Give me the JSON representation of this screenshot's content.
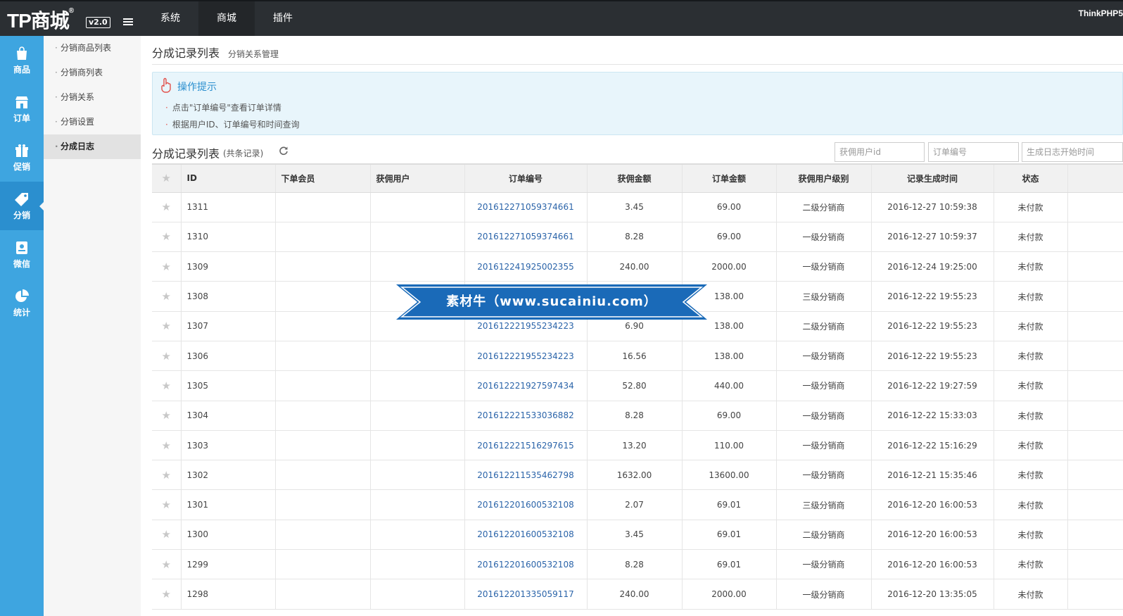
{
  "topbar": {
    "logo": "TP商城",
    "logo_mark": "®",
    "version": "v2.0",
    "tabs": [
      {
        "label": "系统"
      },
      {
        "label": "商城"
      },
      {
        "label": "插件"
      }
    ],
    "right_text": "ThinkPHP5"
  },
  "iconbar": {
    "items": [
      {
        "label": "商品",
        "icon": "shopping-bag-icon"
      },
      {
        "label": "订单",
        "icon": "store-icon"
      },
      {
        "label": "促销",
        "icon": "gift-icon"
      },
      {
        "label": "分销",
        "icon": "tag-icon",
        "active": true
      },
      {
        "label": "微信",
        "icon": "badge-icon"
      },
      {
        "label": "统计",
        "icon": "pie-chart-icon"
      }
    ]
  },
  "submenu": {
    "items": [
      {
        "label": "分销商品列表"
      },
      {
        "label": "分销商列表"
      },
      {
        "label": "分销关系"
      },
      {
        "label": "分销设置"
      },
      {
        "label": "分成日志",
        "active": true
      }
    ]
  },
  "page": {
    "title": "分成记录列表",
    "subtitle": "分销关系管理"
  },
  "tips": {
    "title": "操作提示",
    "items": [
      "点击\"订单编号\"查看订单详情",
      "根据用户ID、订单编号和时间查询"
    ]
  },
  "list": {
    "title": "分成记录列表",
    "count_text": "(共条记录)",
    "filters": {
      "user_id_placeholder": "获佣用户id",
      "order_sn_placeholder": "订单编号",
      "start_time_placeholder": "生成日志开始时间"
    },
    "columns": [
      "ID",
      "下单会员",
      "获佣用户",
      "订单编号",
      "获佣金额",
      "订单金额",
      "获佣用户级别",
      "记录生成时间",
      "状态"
    ],
    "rows": [
      {
        "id": "1311",
        "buyer": "",
        "earner": "",
        "order_sn": "201612271059374661",
        "commission": "3.45",
        "order_amount": "69.00",
        "level": "二级分销商",
        "time": "2016-12-27 10:59:38",
        "status": "未付款"
      },
      {
        "id": "1310",
        "buyer": "",
        "earner": "",
        "order_sn": "201612271059374661",
        "commission": "8.28",
        "order_amount": "69.00",
        "level": "一级分销商",
        "time": "2016-12-27 10:59:37",
        "status": "未付款"
      },
      {
        "id": "1309",
        "buyer": "",
        "earner": "",
        "order_sn": "201612241925002355",
        "commission": "240.00",
        "order_amount": "2000.00",
        "level": "一级分销商",
        "time": "2016-12-24 19:25:00",
        "status": "未付款"
      },
      {
        "id": "1308",
        "buyer": "",
        "earner": "",
        "order_sn": "",
        "commission": "",
        "order_amount": "138.00",
        "level": "三级分销商",
        "time": "2016-12-22 19:55:23",
        "status": "未付款"
      },
      {
        "id": "1307",
        "buyer": "",
        "earner": "",
        "order_sn": "201612221955234223",
        "commission": "6.90",
        "order_amount": "138.00",
        "level": "二级分销商",
        "time": "2016-12-22 19:55:23",
        "status": "未付款"
      },
      {
        "id": "1306",
        "buyer": "",
        "earner": "",
        "order_sn": "201612221955234223",
        "commission": "16.56",
        "order_amount": "138.00",
        "level": "一级分销商",
        "time": "2016-12-22 19:55:23",
        "status": "未付款"
      },
      {
        "id": "1305",
        "buyer": "",
        "earner": "",
        "order_sn": "201612221927597434",
        "commission": "52.80",
        "order_amount": "440.00",
        "level": "一级分销商",
        "time": "2016-12-22 19:27:59",
        "status": "未付款"
      },
      {
        "id": "1304",
        "buyer": "",
        "earner": "",
        "order_sn": "201612221533036882",
        "commission": "8.28",
        "order_amount": "69.00",
        "level": "一级分销商",
        "time": "2016-12-22 15:33:03",
        "status": "未付款"
      },
      {
        "id": "1303",
        "buyer": "",
        "earner": "",
        "order_sn": "201612221516297615",
        "commission": "13.20",
        "order_amount": "110.00",
        "level": "一级分销商",
        "time": "2016-12-22 15:16:29",
        "status": "未付款"
      },
      {
        "id": "1302",
        "buyer": "",
        "earner": "",
        "order_sn": "201612211535462798",
        "commission": "1632.00",
        "order_amount": "13600.00",
        "level": "一级分销商",
        "time": "2016-12-21 15:35:46",
        "status": "未付款"
      },
      {
        "id": "1301",
        "buyer": "",
        "earner": "",
        "order_sn": "201612201600532108",
        "commission": "2.07",
        "order_amount": "69.01",
        "level": "三级分销商",
        "time": "2016-12-20 16:00:53",
        "status": "未付款"
      },
      {
        "id": "1300",
        "buyer": "",
        "earner": "",
        "order_sn": "201612201600532108",
        "commission": "3.45",
        "order_amount": "69.01",
        "level": "二级分销商",
        "time": "2016-12-20 16:00:53",
        "status": "未付款"
      },
      {
        "id": "1299",
        "buyer": "",
        "earner": "",
        "order_sn": "201612201600532108",
        "commission": "8.28",
        "order_amount": "69.01",
        "level": "一级分销商",
        "time": "2016-12-20 16:00:53",
        "status": "未付款"
      },
      {
        "id": "1298",
        "buyer": "",
        "earner": "",
        "order_sn": "201612201335059117",
        "commission": "240.00",
        "order_amount": "2000.00",
        "level": "一级分销商",
        "time": "2016-12-20 13:35:05",
        "status": "未付款"
      }
    ]
  },
  "watermark": {
    "text": "素材牛（www.sucainiu.com）"
  },
  "colors": {
    "topbar_bg": "#2b2f33",
    "sidebar_bg": "#3ea5e0",
    "link": "#2b64a9",
    "watermark_bg": "#1a6ab8"
  }
}
